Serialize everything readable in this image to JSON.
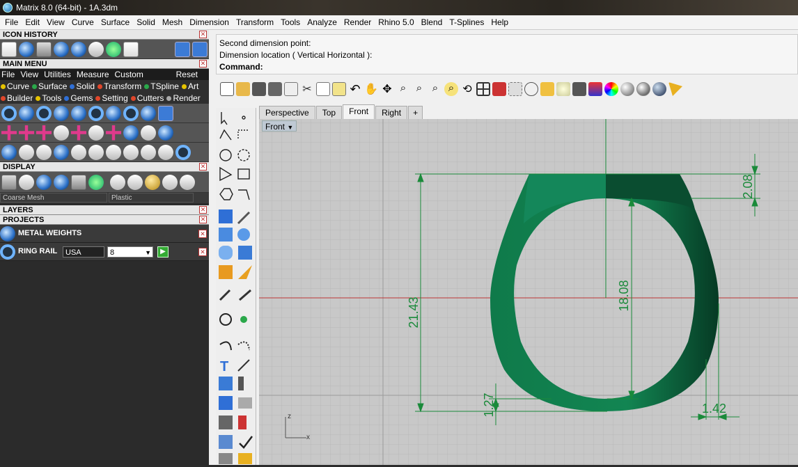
{
  "window": {
    "title": "Matrix 8.0 (64-bit) - 1A.3dm"
  },
  "menubar": [
    "File",
    "Edit",
    "View",
    "Curve",
    "Surface",
    "Solid",
    "Mesh",
    "Dimension",
    "Transform",
    "Tools",
    "Analyze",
    "Render",
    "Rhino 5.0",
    "Blend",
    "T-Splines",
    "Help"
  ],
  "left": {
    "icon_history": "ICON HISTORY",
    "main_menu": "MAIN MENU",
    "menu_items": [
      "File",
      "View",
      "Utilities",
      "Measure",
      "Custom"
    ],
    "reset": "Reset",
    "tabs_row1": [
      {
        "label": "Curve",
        "color": "#e6c300"
      },
      {
        "label": "Surface",
        "color": "#2aa84a"
      },
      {
        "label": "Solid",
        "color": "#2f6fd6"
      },
      {
        "label": "Transform",
        "color": "#e0462a"
      },
      {
        "label": "TSpline",
        "color": "#2aa84a"
      },
      {
        "label": "Art",
        "color": "#e6c300"
      }
    ],
    "tabs_row2": [
      {
        "label": "Builder",
        "color": "#e0462a"
      },
      {
        "label": "Tools",
        "color": "#e6c300"
      },
      {
        "label": "Gems",
        "color": "#2f6fd6"
      },
      {
        "label": "Setting",
        "color": "#e0462a"
      },
      {
        "label": "Cutters",
        "color": "#e0462a"
      },
      {
        "label": "Render",
        "color": "#aaaaaa"
      }
    ],
    "display": "DISPLAY",
    "mesh_combo": "Coarse Mesh",
    "material_combo": "Plastic",
    "layers": "LAYERS",
    "projects": "PROJECTS",
    "metal_weights": "METAL WEIGHTS",
    "ring_rail": "RING RAIL",
    "ring_region": "USA",
    "ring_size": "8"
  },
  "command": {
    "line1": "Second dimension point:",
    "line2": "Dimension location ( Vertical  Horizontal ):",
    "prompt": "Command:"
  },
  "viewport": {
    "tabs": [
      "Perspective",
      "Top",
      "Front",
      "Right"
    ],
    "active_tab": "Front",
    "label": "Front",
    "dims": {
      "total_height": "21.43",
      "inner_height": "18.08",
      "top_thickness": "2.08",
      "bottom_thickness": "1.27",
      "side_width": "1.42"
    },
    "axes": {
      "z": "z",
      "x": "x"
    }
  },
  "colors": {
    "ring_green": "#0f7a4a",
    "ring_dark": "#0a4d30",
    "dim_line": "#1a8a3a",
    "viewport_bg": "#c8c8c8"
  }
}
